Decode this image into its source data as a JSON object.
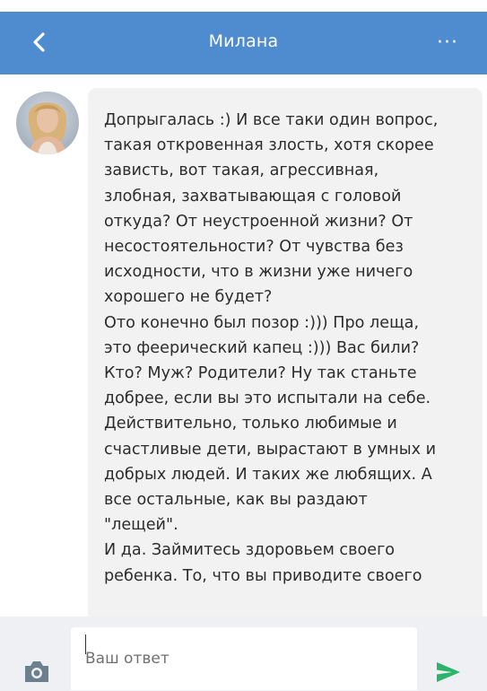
{
  "header": {
    "title": "Милана",
    "back_icon": "chevron-left-icon",
    "more_label": "···"
  },
  "conversation": {
    "message": {
      "text": "Допрыгалась :) И все таки один вопрос,\nтакая откровенная злость, хотя скорее\nзависть, вот такая, агрессивная,\nзлобная, захватывающая с головой\nоткуда? От неустроенной жизни? От\nнесостоятельности? От чувства без\nисходности, что в жизни уже ничего\nхорошего не будет?\nОто конечно был позор :))) Про леща,\nэто феерический капец :))) Вас били?\nКто? Муж? Родители? Ну так станьте\nдобрее, если вы это испытали на себе.\nДействительно, только любимые и\nсчастливые дети, вырастают в умных и\nдобрых людей. И таких же любящих. А\nвсе остальные, как вы раздают\n\"лещей\".\nИ да. Займитесь здоровьем своего\nребенка. То, что вы приводите своего"
    }
  },
  "composer": {
    "placeholder": "Ваш ответ",
    "value": ""
  },
  "colors": {
    "header_bg": "#4e8bcf",
    "bubble_bg": "#f2f2f2",
    "send_green": "#2eb36b",
    "camera_gray": "#6b7f8c"
  }
}
